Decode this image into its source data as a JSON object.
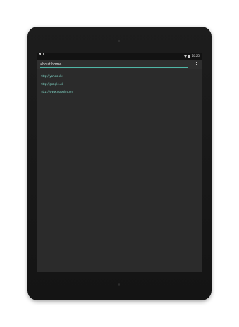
{
  "browser": {
    "address": "about:home"
  },
  "status_bar": {
    "time": "10:25"
  },
  "links": [
    "http://yahoo.uk",
    "http://google.uk",
    "http://www.google.com"
  ],
  "icons": [
    "wifi-icon",
    "battery-icon",
    "notification-icon",
    "overflow-menu-icon"
  ],
  "colors": {
    "accent": "#4fb6a6",
    "link": "#7fd3c4",
    "screen_bg": "#2b2b2b"
  }
}
